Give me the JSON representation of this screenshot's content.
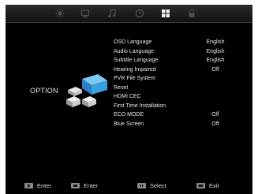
{
  "tabs": [
    {
      "icon": "picture-icon",
      "active": false
    },
    {
      "icon": "screen-icon",
      "active": false
    },
    {
      "icon": "music-note-icon",
      "active": false
    },
    {
      "icon": "clock-icon",
      "active": false
    },
    {
      "icon": "option-grid-icon",
      "active": true
    },
    {
      "icon": "lock-icon",
      "active": false
    }
  ],
  "category": {
    "label": "OPTION",
    "icon": "option-cubes-icon"
  },
  "menu": {
    "items": [
      {
        "label": "OSD Language",
        "value": "English"
      },
      {
        "label": "Audio Language",
        "value": "English"
      },
      {
        "label": "Subtitle Language",
        "value": "English"
      },
      {
        "label": "Hearing Impaired",
        "value": "Off"
      },
      {
        "label": "PVR File System",
        "value": ""
      },
      {
        "label": "Reset",
        "value": ""
      },
      {
        "label": "HDMI CEC",
        "value": ""
      },
      {
        "label": "First Time Installation",
        "value": ""
      },
      {
        "label": "ECO MODE",
        "value": "Off"
      },
      {
        "label": "Blue Screen",
        "value": "Off"
      }
    ]
  },
  "hints": [
    {
      "key_icon": "right-arrow-key-icon",
      "label": "Enter"
    },
    {
      "key_icon": "ok-key-icon",
      "label": "Enter"
    },
    {
      "key_icon": "up-down-key-icon",
      "label": "Select"
    },
    {
      "key_icon": "exit-key-icon",
      "label": "Exit"
    }
  ],
  "colors": {
    "background": "#000000",
    "text": "#e6e6e6",
    "accent": "#3aa0e0",
    "icon_inactive": "#555555",
    "icon_active": "#f0f0f0"
  }
}
